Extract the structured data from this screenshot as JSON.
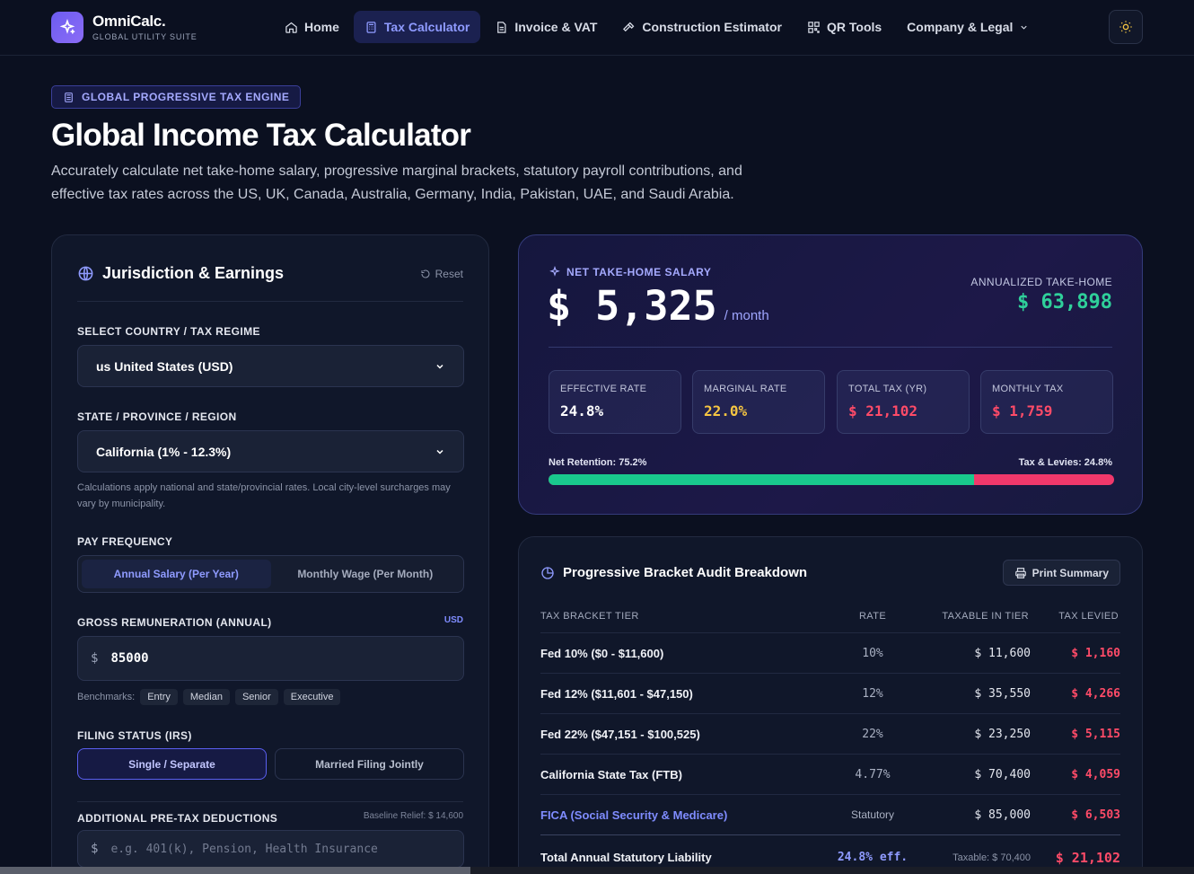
{
  "nav": {
    "brand_name": "OmniCalc.",
    "brand_sub": "GLOBAL UTILITY SUITE",
    "items": [
      {
        "label": "Home",
        "icon": "home-icon"
      },
      {
        "label": "Tax Calculator",
        "icon": "calculator-icon"
      },
      {
        "label": "Invoice & VAT",
        "icon": "document-icon"
      },
      {
        "label": "Construction Estimator",
        "icon": "hammer-icon"
      },
      {
        "label": "QR Tools",
        "icon": "qr-icon"
      },
      {
        "label": "Company & Legal",
        "icon": "chevron-down-icon"
      }
    ],
    "active_index": 1,
    "accent": "#8f9bff"
  },
  "hero": {
    "badge": "GLOBAL PROGRESSIVE TAX ENGINE",
    "title": "Global Income Tax Calculator",
    "lead": "Accurately calculate net take-home salary, progressive marginal brackets, statutory payroll contributions, and effective tax rates across the US, UK, Canada, Australia, Germany, India, Pakistan, UAE, and Saudi Arabia."
  },
  "form": {
    "title": "Jurisdiction & Earnings",
    "reset_label": "Reset",
    "country_label": "SELECT COUNTRY / TAX REGIME",
    "country_value": "us United States (USD)",
    "state_label": "STATE / PROVINCE / REGION",
    "state_value": "California (1% - 12.3%)",
    "state_hint": "Calculations apply national and state/provincial rates. Local city-level surcharges may vary by municipality.",
    "freq_label": "PAY FREQUENCY",
    "freq_options": [
      "Annual Salary (Per Year)",
      "Monthly Wage (Per Month)"
    ],
    "gross_label": "GROSS REMUNERATION (ANNUAL)",
    "currency": "USD",
    "currency_symbol": "$",
    "gross_value": "85000",
    "benchmarks_label": "Benchmarks:",
    "benchmarks": [
      "Entry",
      "Median",
      "Senior",
      "Executive"
    ],
    "filing_label": "FILING STATUS (IRS)",
    "filing_options": [
      "Single / Separate",
      "Married Filing Jointly"
    ],
    "deductions_label": "ADDITIONAL PRE-TAX DEDUCTIONS",
    "baseline_relief": "Baseline Relief: $ 14,600",
    "deductions_placeholder": "e.g. 401(k), Pension, Health Insurance"
  },
  "summary": {
    "net_label": "NET TAKE-HOME SALARY",
    "net_amount": "$ 5,325",
    "net_period": "/ month",
    "annual_label": "ANNUALIZED TAKE-HOME",
    "annual_amount": "$ 63,898",
    "stats": [
      {
        "label": "EFFECTIVE RATE",
        "value": "24.8%",
        "color": "#ffffff"
      },
      {
        "label": "MARGINAL RATE",
        "value": "22.0%",
        "color": "#f5c542"
      },
      {
        "label": "TOTAL TAX (YR)",
        "value": "$ 21,102",
        "color": "#ff4b68"
      },
      {
        "label": "MONTHLY TAX",
        "value": "$ 1,759",
        "color": "#ff4b68"
      }
    ],
    "retention_label": "Net Retention: 75.2%",
    "levies_label": "Tax & Levies: 24.8%",
    "retention_fraction": 0.752
  },
  "breakdown": {
    "title": "Progressive Bracket Audit Breakdown",
    "print_label": "Print Summary",
    "headers": [
      "TAX BRACKET TIER",
      "RATE",
      "TAXABLE IN TIER",
      "TAX LEVIED"
    ],
    "rows": [
      {
        "tier": "Fed 10% ($0 - $11,600)",
        "rate": "10%",
        "taxable": "$ 11,600",
        "levied": "$ 1,160"
      },
      {
        "tier": "Fed 12% ($11,601 - $47,150)",
        "rate": "12%",
        "taxable": "$ 35,550",
        "levied": "$ 4,266"
      },
      {
        "tier": "Fed 22% ($47,151 - $100,525)",
        "rate": "22%",
        "taxable": "$ 23,250",
        "levied": "$ 5,115"
      },
      {
        "tier": "California State Tax (FTB)",
        "rate": "4.77%",
        "taxable": "$ 70,400",
        "levied": "$ 4,059"
      },
      {
        "tier": "FICA (Social Security & Medicare)",
        "rate": "Statutory",
        "taxable": "$ 85,000",
        "levied": "$ 6,503"
      }
    ],
    "total": {
      "tier": "Total Annual Statutory Liability",
      "rate": "24.8% eff.",
      "taxable": "Taxable: $ 70,400",
      "levied": "$ 21,102"
    }
  }
}
